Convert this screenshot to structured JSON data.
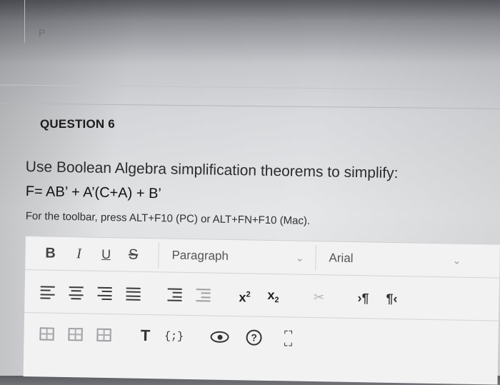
{
  "previous": {
    "label": "P"
  },
  "question": {
    "title": "QUESTION 6",
    "text": "Use Boolean Algebra simplification theorems to simplify:",
    "formula": "F= AB’ + A’(C+A) + B’",
    "toolbar_hint": "For the toolbar, press ALT+F10 (PC) or ALT+FN+F10 (Mac)."
  },
  "toolbar": {
    "bold": "B",
    "italic": "I",
    "underline": "U",
    "strike": "S",
    "format_value": "Paragraph",
    "font_value": "Arial",
    "superscript": "x",
    "subscript": "x",
    "sup_mark": "2",
    "sub_mark": "2",
    "ltr": "›¶",
    "rtl": "¶‹",
    "code": "{;}",
    "tee": "T",
    "help": "?"
  }
}
